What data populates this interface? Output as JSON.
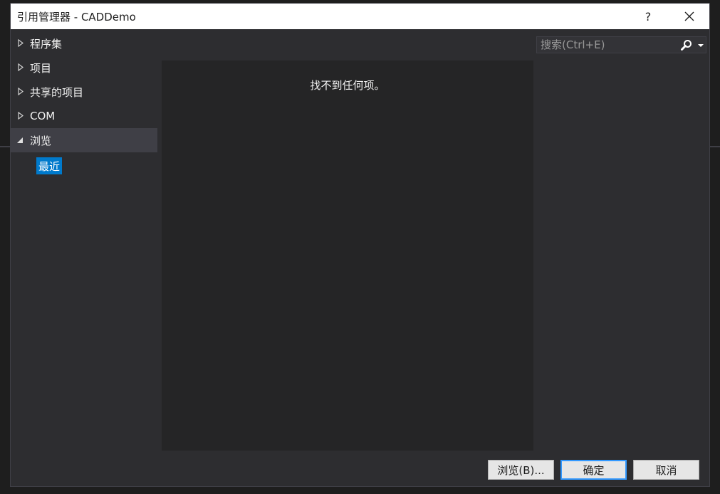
{
  "window": {
    "title": "引用管理器 - CADDemo",
    "help_label": "?",
    "close_label": "✕"
  },
  "sidebar": {
    "items": [
      {
        "label": "程序集",
        "expanded": false
      },
      {
        "label": "项目",
        "expanded": false
      },
      {
        "label": "共享的项目",
        "expanded": false
      },
      {
        "label": "COM",
        "expanded": false
      },
      {
        "label": "浏览",
        "expanded": true
      }
    ],
    "sub_items": [
      {
        "label": "最近",
        "selected": true
      }
    ]
  },
  "content": {
    "empty_message": "找不到任何项。"
  },
  "search": {
    "placeholder": "搜索(Ctrl+E)",
    "value": ""
  },
  "footer": {
    "browse_label": "浏览(B)...",
    "ok_label": "确定",
    "cancel_label": "取消"
  },
  "colors": {
    "background": "#1e1e1e",
    "dialog": "#2d2d30",
    "content": "#252526",
    "selection": "#007acc",
    "titlebar": "#ffffff"
  }
}
